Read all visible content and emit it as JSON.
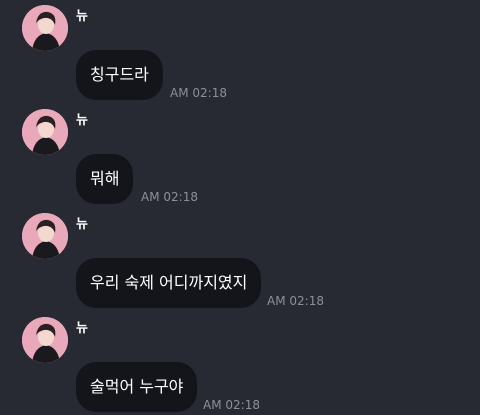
{
  "colors": {
    "background": "#272933",
    "bubble": "#14151a",
    "text": "#ffffff",
    "timestamp": "#8d8f97",
    "avatar_pink": "#e7a2b6"
  },
  "messages": [
    {
      "sender": "뉴",
      "avatar_icon": "profile-photo",
      "text": "칭구드라",
      "time": "AM 02:18"
    },
    {
      "sender": "뉴",
      "avatar_icon": "profile-photo",
      "text": "뭐해",
      "time": "AM 02:18"
    },
    {
      "sender": "뉴",
      "avatar_icon": "profile-photo",
      "text": "우리 숙제 어디까지였지",
      "time": "AM 02:18"
    },
    {
      "sender": "뉴",
      "avatar_icon": "profile-photo",
      "text": "술먹어 누구야",
      "time": "AM 02:18"
    }
  ]
}
